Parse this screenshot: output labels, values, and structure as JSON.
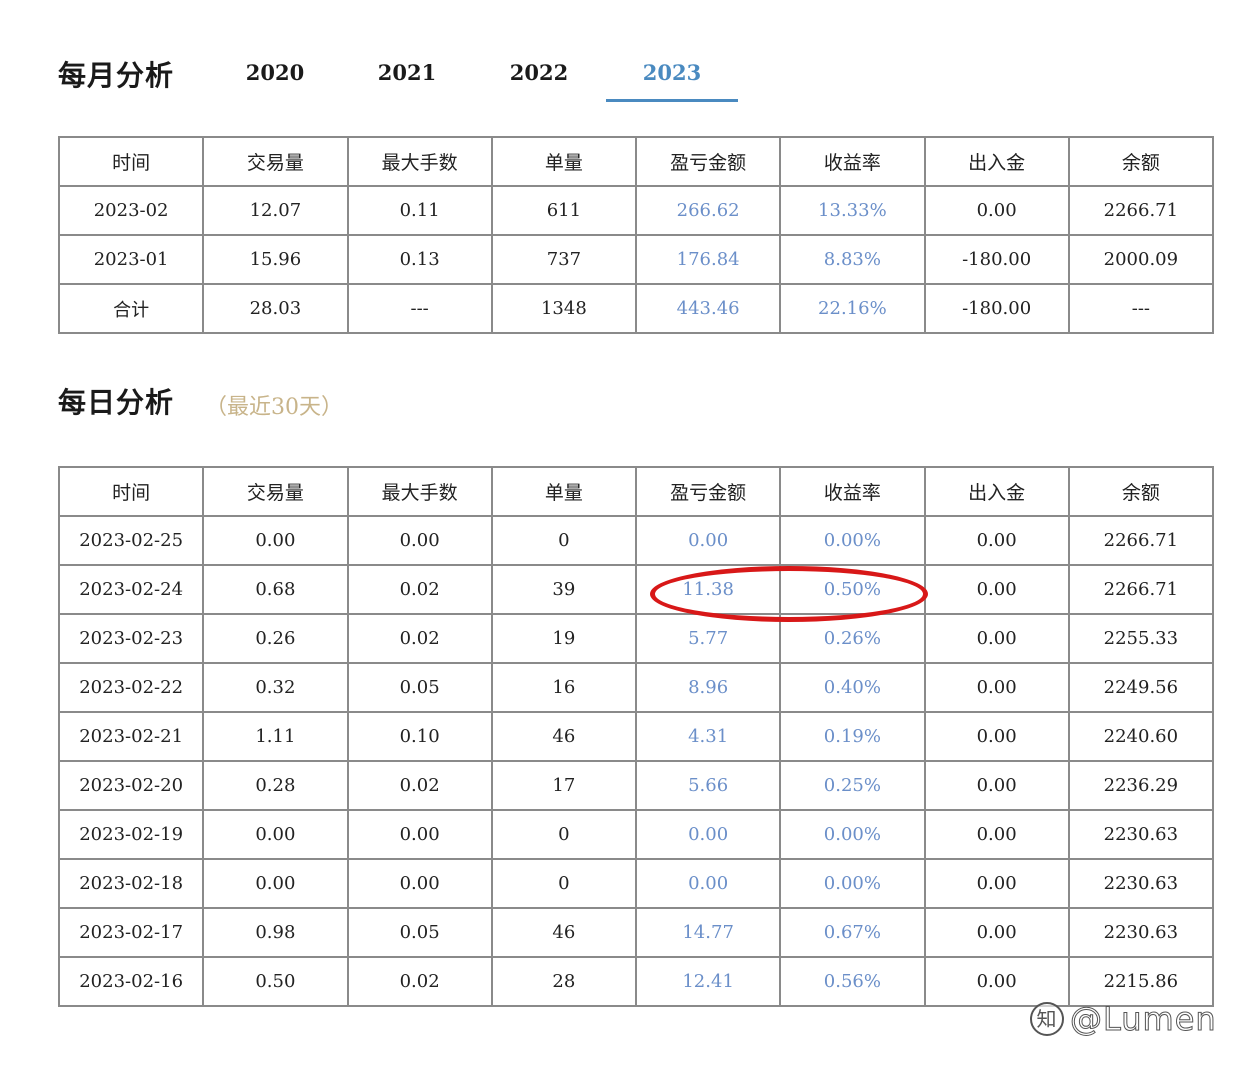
{
  "monthly": {
    "title": "每月分析",
    "tabs": [
      "2020",
      "2021",
      "2022",
      "2023"
    ],
    "active_tab": "2023",
    "columns": [
      "时间",
      "交易量",
      "最大手数",
      "单量",
      "盈亏金额",
      "收益率",
      "出入金",
      "余额"
    ],
    "rows": [
      [
        "2023-02",
        "12.07",
        "0.11",
        "611",
        "266.62",
        "13.33%",
        "0.00",
        "2266.71"
      ],
      [
        "2023-01",
        "15.96",
        "0.13",
        "737",
        "176.84",
        "8.83%",
        "-180.00",
        "2000.09"
      ],
      [
        "合计",
        "28.03",
        "---",
        "1348",
        "443.46",
        "22.16%",
        "-180.00",
        "---"
      ]
    ]
  },
  "daily": {
    "title": "每日分析",
    "subtitle": "（最近30天）",
    "columns": [
      "时间",
      "交易量",
      "最大手数",
      "单量",
      "盈亏金额",
      "收益率",
      "出入金",
      "余额"
    ],
    "rows": [
      [
        "2023-02-25",
        "0.00",
        "0.00",
        "0",
        "0.00",
        "0.00%",
        "0.00",
        "2266.71"
      ],
      [
        "2023-02-24",
        "0.68",
        "0.02",
        "39",
        "11.38",
        "0.50%",
        "0.00",
        "2266.71"
      ],
      [
        "2023-02-23",
        "0.26",
        "0.02",
        "19",
        "5.77",
        "0.26%",
        "0.00",
        "2255.33"
      ],
      [
        "2023-02-22",
        "0.32",
        "0.05",
        "16",
        "8.96",
        "0.40%",
        "0.00",
        "2249.56"
      ],
      [
        "2023-02-21",
        "1.11",
        "0.10",
        "46",
        "4.31",
        "0.19%",
        "0.00",
        "2240.60"
      ],
      [
        "2023-02-20",
        "0.28",
        "0.02",
        "17",
        "5.66",
        "0.25%",
        "0.00",
        "2236.29"
      ],
      [
        "2023-02-19",
        "0.00",
        "0.00",
        "0",
        "0.00",
        "0.00%",
        "0.00",
        "2230.63"
      ],
      [
        "2023-02-18",
        "0.00",
        "0.00",
        "0",
        "0.00",
        "0.00%",
        "0.00",
        "2230.63"
      ],
      [
        "2023-02-17",
        "0.98",
        "0.05",
        "46",
        "14.77",
        "0.67%",
        "0.00",
        "2230.63"
      ],
      [
        "2023-02-16",
        "0.50",
        "0.02",
        "28",
        "12.41",
        "0.56%",
        "0.00",
        "2215.86"
      ]
    ]
  },
  "watermark": {
    "text": "@Lumen",
    "logo": "知"
  },
  "colors": {
    "accent": "#4a8ac0",
    "link_value": "#6b8fc9",
    "subtitle": "#c8b48a",
    "highlight": "#d81818",
    "border": "#8a8a8a"
  }
}
